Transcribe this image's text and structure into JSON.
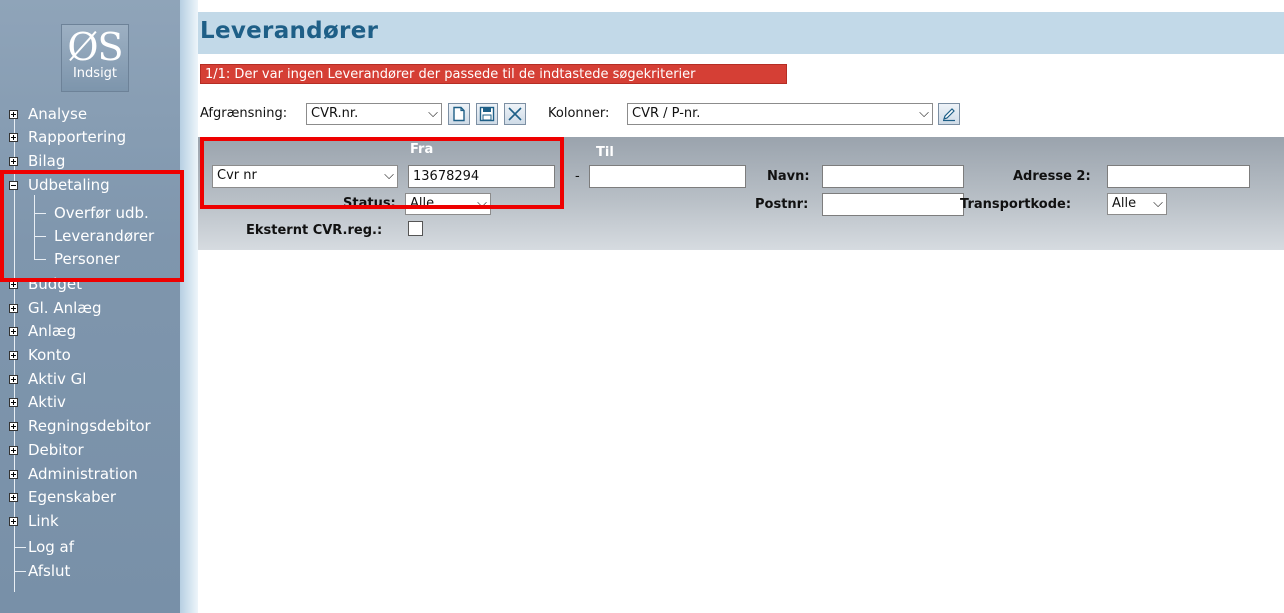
{
  "logo": {
    "big": "ØS",
    "small": "Indsigt"
  },
  "nav": [
    {
      "label": "Analyse",
      "toggle": "plus"
    },
    {
      "label": "Rapportering",
      "toggle": "plus"
    },
    {
      "label": "Bilag",
      "toggle": "plus"
    },
    {
      "label": "Udbetaling",
      "toggle": "minus"
    },
    {
      "label": "Overfør udb.",
      "sub": true
    },
    {
      "label": "Leverandører",
      "sub": true
    },
    {
      "label": "Personer",
      "sub": true
    },
    {
      "label": "Budget",
      "toggle": "plus"
    },
    {
      "label": "Gl. Anlæg",
      "toggle": "plus"
    },
    {
      "label": "Anlæg",
      "toggle": "plus"
    },
    {
      "label": "Konto",
      "toggle": "plus"
    },
    {
      "label": "Aktiv Gl",
      "toggle": "plus"
    },
    {
      "label": "Aktiv",
      "toggle": "plus"
    },
    {
      "label": "Regningsdebitor",
      "toggle": "plus"
    },
    {
      "label": "Debitor",
      "toggle": "plus"
    },
    {
      "label": "Administration",
      "toggle": "plus"
    },
    {
      "label": "Egenskaber",
      "toggle": "plus"
    },
    {
      "label": "Link",
      "toggle": "plus"
    },
    {
      "label": "Log af"
    },
    {
      "label": "Afslut"
    }
  ],
  "page": {
    "title": "Leverandører",
    "error": "1/1: Der var ingen Leverandører der passede til de indtastede søgekriterier"
  },
  "toolbar": {
    "afgraensning_label": "Afgrænsning:",
    "afgraensning_value": "CVR.nr.",
    "kolonner_label": "Kolonner:",
    "kolonner_value": "CVR / P-nr."
  },
  "filter": {
    "field_select": "Cvr nr",
    "fra_label": "Fra",
    "fra_value": "13678294",
    "dash": "-",
    "til_label": "Til",
    "til_value": "",
    "status_label": "Status:",
    "status_value": "Alle",
    "eksternt_label": "Eksternt CVR.reg.:",
    "navn_label": "Navn:",
    "navn_value": "",
    "postnr_label": "Postnr:",
    "postnr_value": "",
    "adresse2_label": "Adresse 2:",
    "adresse2_value": "",
    "transportkode_label": "Transportkode:",
    "transportkode_value": "Alle"
  },
  "colors": {
    "annotation": "#ee0000",
    "title": "#1e5f87",
    "error_bg": "#d53f35"
  },
  "icons": [
    "new-document-icon",
    "save-icon",
    "delete-icon",
    "edit-columns-icon",
    "chevron-down-icon"
  ]
}
